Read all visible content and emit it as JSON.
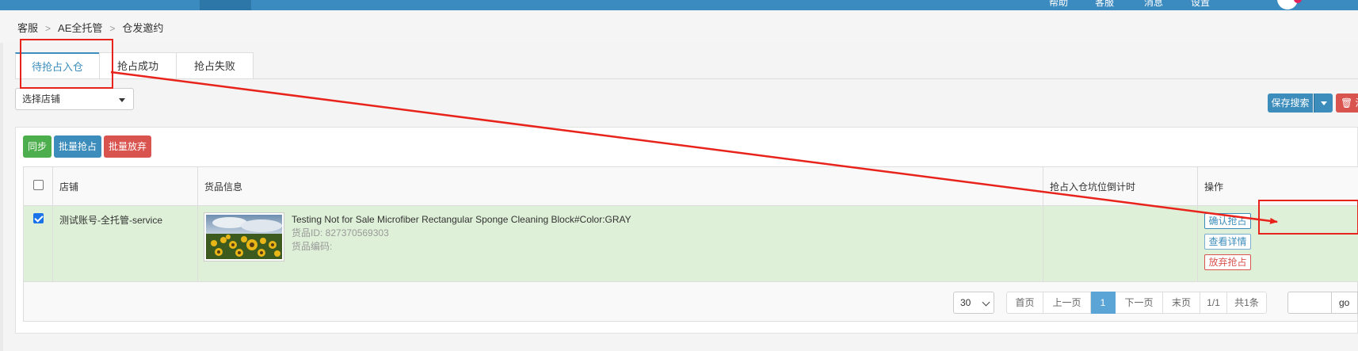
{
  "topnav": {
    "items": [
      "帮助",
      "客服",
      "消息",
      "设置"
    ]
  },
  "breadcrumb": {
    "items": [
      "客服",
      "AE全托管",
      "仓发邀约"
    ]
  },
  "tabs": [
    {
      "label": "待抢占入仓",
      "active": true
    },
    {
      "label": "抢占成功",
      "active": false
    },
    {
      "label": "抢占失败",
      "active": false
    }
  ],
  "shop_select": {
    "value": "选择店铺"
  },
  "actions": {
    "save_search": "保存搜索",
    "delete_label": "清"
  },
  "toolbar": {
    "sync": "同步",
    "batch_grab": "批量抢占",
    "batch_abandon": "批量放弃"
  },
  "table": {
    "headers": [
      "店铺",
      "货品信息",
      "抢占入仓坑位倒计时",
      "操作"
    ],
    "rows": [
      {
        "checked": true,
        "shop": "测试账号-全托管-service",
        "product_title": "Testing Not for Sale Microfiber Rectangular Sponge Cleaning Block#Color:GRAY",
        "product_id": "货品ID: 827370569303",
        "product_code": "货品编码:",
        "countdown": "",
        "ops": [
          "确认抢占",
          "查看详情",
          "放弃抢占"
        ]
      }
    ]
  },
  "pagination": {
    "page_size": "30",
    "first": "首页",
    "prev": "上一页",
    "current": "1",
    "next": "下一页",
    "last": "末页",
    "pages": "1/1",
    "total": "共1条",
    "go": "go"
  },
  "colors": {
    "annotation": "#e8231b",
    "primary": "#3c8dbc",
    "success": "#4cae4c",
    "danger": "#d9534f",
    "selected_row": "#dff0d8"
  }
}
